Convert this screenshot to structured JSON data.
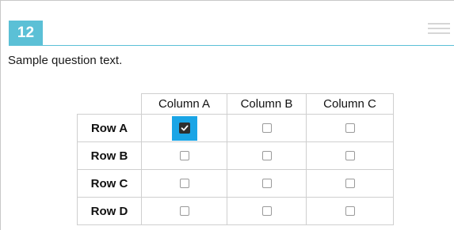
{
  "question": {
    "number": "12",
    "text": "Sample question text."
  },
  "matrix": {
    "columns": [
      "Column A",
      "Column B",
      "Column C"
    ],
    "rows": [
      {
        "label": "Row A",
        "checked": [
          true,
          false,
          false
        ]
      },
      {
        "label": "Row B",
        "checked": [
          false,
          false,
          false
        ]
      },
      {
        "label": "Row C",
        "checked": [
          false,
          false,
          false
        ]
      },
      {
        "label": "Row D",
        "checked": [
          false,
          false,
          false
        ]
      }
    ]
  },
  "icons": {
    "menu": "hamburger-menu-icon",
    "checkmark": "checkmark-icon"
  },
  "colors": {
    "accent": "#5bc0d6",
    "selected": "#1aa5e6"
  }
}
